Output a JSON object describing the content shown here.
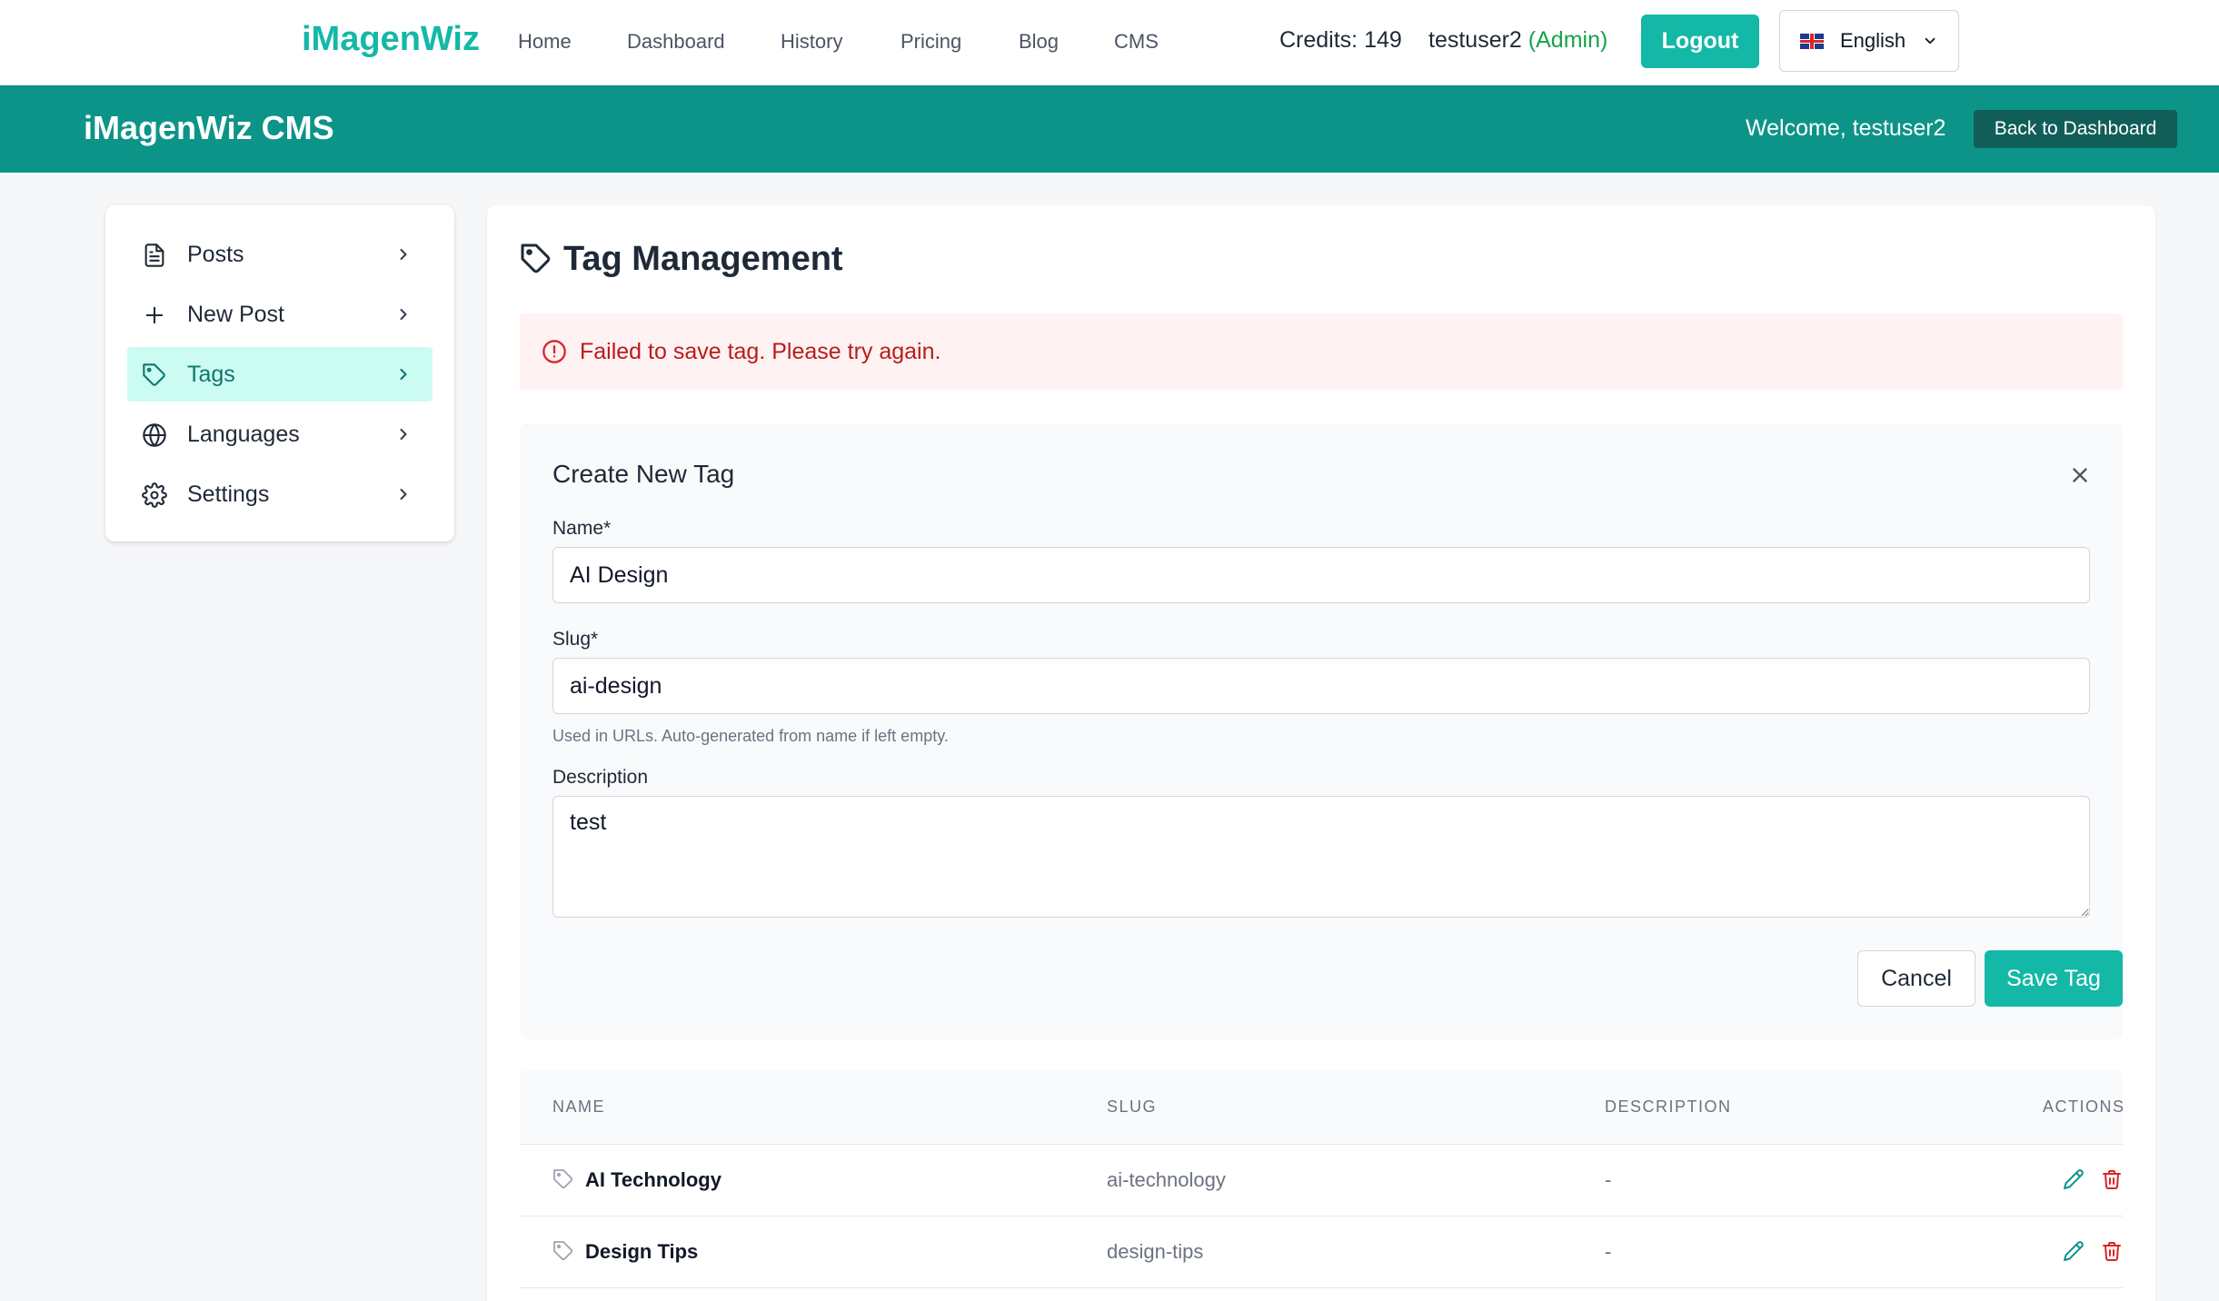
{
  "topnav": {
    "brand": "iMagenWiz",
    "links": [
      "Home",
      "Dashboard",
      "History",
      "Pricing",
      "Blog",
      "CMS"
    ],
    "credits": "Credits: 149",
    "username": "testuser2",
    "role": "(Admin)",
    "logout_label": "Logout",
    "language": "English",
    "flag_icon": "uk-flag-icon"
  },
  "cms_header": {
    "title": "iMagenWiz CMS",
    "welcome": "Welcome, testuser2",
    "back_label": "Back to Dashboard"
  },
  "sidebar": {
    "items": [
      {
        "label": "Posts",
        "icon": "document-icon"
      },
      {
        "label": "New Post",
        "icon": "plus-icon"
      },
      {
        "label": "Tags",
        "icon": "tag-icon",
        "active": true
      },
      {
        "label": "Languages",
        "icon": "globe-icon"
      },
      {
        "label": "Settings",
        "icon": "gear-icon"
      }
    ]
  },
  "main": {
    "title": "Tag Management",
    "alert": "Failed to save tag. Please try again.",
    "form": {
      "title": "Create New Tag",
      "name_label": "Name*",
      "name_value": "AI Design",
      "slug_label": "Slug*",
      "slug_value": "ai-design",
      "slug_hint": "Used in URLs. Auto-generated from name if left empty.",
      "description_label": "Description",
      "description_value": "test",
      "cancel_label": "Cancel",
      "save_label": "Save Tag"
    },
    "table": {
      "headers": [
        "NAME",
        "SLUG",
        "DESCRIPTION",
        "ACTIONS"
      ],
      "rows": [
        {
          "name": "AI Technology",
          "slug": "ai-technology",
          "description": "-"
        },
        {
          "name": "Design Tips",
          "slug": "design-tips",
          "description": "-"
        }
      ]
    }
  },
  "colors": {
    "accent": "#14b8a6",
    "header_bg": "#0d9488",
    "error_text": "#b91c1c",
    "error_bg": "#fef2f2",
    "admin_green": "#16a34a"
  }
}
